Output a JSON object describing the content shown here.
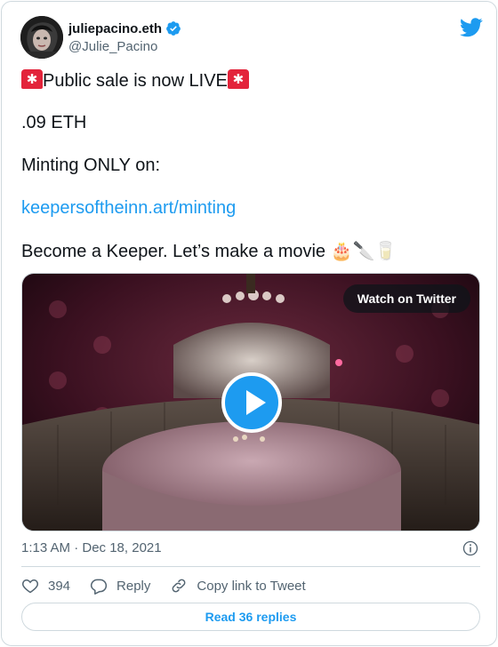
{
  "author": {
    "display_name": "juliepacino.eth",
    "handle": "@Julie_Pacino",
    "verified": true
  },
  "tweet": {
    "line1": "Public sale is now LIVE",
    "line2": ".09 ETH",
    "line3": "Minting ONLY on:",
    "link": "keepersoftheinn.art/minting",
    "line5": "Become a Keeper. Let’s make a movie",
    "line5_emojis": "🎂🔪🥛"
  },
  "media": {
    "watch_label": "Watch on Twitter"
  },
  "meta": {
    "timestamp": "1:13 AM · Dec 18, 2021"
  },
  "actions": {
    "likes_count": "394",
    "reply_label": "Reply",
    "copy_label": "Copy link to Tweet"
  },
  "footer": {
    "read_replies_label": "Read 36 replies"
  },
  "colors": {
    "accent": "#1d9bf0",
    "text": "#0f1419",
    "muted": "#536471",
    "border": "#cfd9de"
  }
}
